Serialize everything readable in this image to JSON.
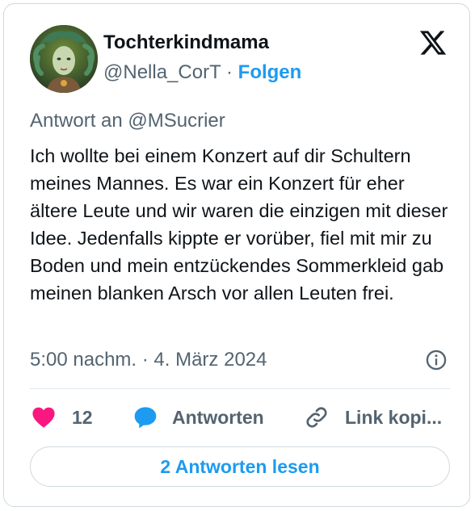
{
  "author": {
    "display_name": "Tochterkindmama",
    "handle": "@Nella_CorT",
    "separator": "·",
    "follow_label": "Folgen"
  },
  "reply_to": "Antwort an @MSucrier",
  "tweet": {
    "text": "Ich wollte bei einem Konzert auf dir Schultern meines Mannes. Es war ein Konzert für eher ältere Leute und wir waren die einzigen mit dieser Idee. Jedenfalls kippte er vorüber, fiel mit mir zu Boden und mein entzückendes Sommerkleid gab meinen blanken Arsch vor allen Leuten frei.",
    "timestamp": "5:00 nachm. · 4. März 2024"
  },
  "actions": {
    "like_count": "12",
    "reply_label": "Antworten",
    "copy_link_label": "Link kopi..."
  },
  "read_replies_label": "2 Antworten lesen",
  "icons": {
    "logo": "x-logo-icon",
    "info": "info-icon",
    "like": "heart-icon",
    "reply": "speech-bubble-icon",
    "copy": "link-icon"
  },
  "colors": {
    "accent": "#1d9bf0",
    "like": "#f91880",
    "text": "#0f1419",
    "secondary": "#536471"
  }
}
